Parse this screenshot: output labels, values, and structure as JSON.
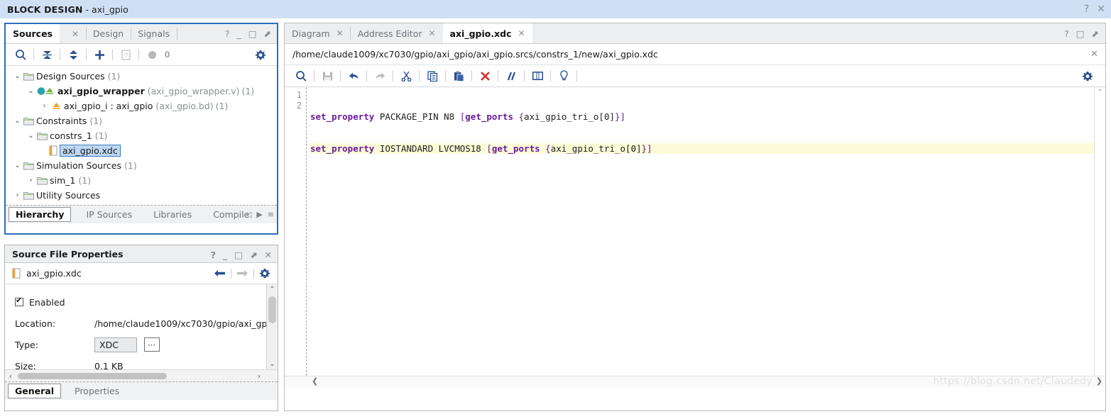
{
  "banner": {
    "title_bold": "BLOCK DESIGN",
    "title_rest": " - axi_gpio",
    "help_icon": "?",
    "close_icon": "✕"
  },
  "sources_panel": {
    "tabs": [
      {
        "label": "Sources",
        "active": true,
        "closable": true
      },
      {
        "label": "Design",
        "active": false,
        "closable": false
      },
      {
        "label": "Signals",
        "active": false,
        "closable": false
      }
    ],
    "close_glyph": "✕",
    "window_controls": [
      "?",
      "_",
      "□",
      "⬈"
    ],
    "toolbar": {
      "search_icon": "search-icon",
      "collapse_icon": "collapse-all-icon",
      "expand_icon": "expand-all-icon",
      "add_icon": "add-sources-icon",
      "file_icon": "report-icon",
      "status_icon": "circle-icon",
      "status_count": "0",
      "settings_icon": "gear-icon"
    },
    "tree": [
      {
        "indent": 0,
        "arrow": "v",
        "icon": "folder",
        "label": "Design Sources",
        "suffix": "(1)",
        "bold": false,
        "selected": false
      },
      {
        "indent": 1,
        "arrow": "v",
        "icon": "module",
        "label": "axi_gpio_wrapper",
        "suffix2": "(axi_gpio_wrapper.v)",
        "suffix": "(1)",
        "bold": true,
        "selected": false
      },
      {
        "indent": 2,
        "arrow": ">",
        "icon": "bd",
        "label": "axi_gpio_i : axi_gpio",
        "suffix2": "(axi_gpio.bd)",
        "suffix": "(1)",
        "bold": false,
        "selected": false
      },
      {
        "indent": 0,
        "arrow": "v",
        "icon": "folder",
        "label": "Constraints",
        "suffix": "(1)",
        "bold": false,
        "selected": false
      },
      {
        "indent": 1,
        "arrow": "v",
        "icon": "folder",
        "label": "constrs_1",
        "suffix": "(1)",
        "bold": false,
        "selected": false
      },
      {
        "indent": 2,
        "arrow": "",
        "icon": "xdc",
        "label": "axi_gpio.xdc",
        "suffix": "",
        "bold": false,
        "selected": true
      },
      {
        "indent": 0,
        "arrow": "v",
        "icon": "folder",
        "label": "Simulation Sources",
        "suffix": "(1)",
        "bold": false,
        "selected": false
      },
      {
        "indent": 1,
        "arrow": ">",
        "icon": "folder",
        "label": "sim_1",
        "suffix": "(1)",
        "bold": false,
        "selected": false
      },
      {
        "indent": 0,
        "arrow": ">",
        "icon": "folder",
        "label": "Utility Sources",
        "suffix": "",
        "bold": false,
        "selected": false
      }
    ],
    "bottom_tabs": [
      {
        "label": "Hierarchy",
        "active": true
      },
      {
        "label": "IP Sources",
        "active": false
      },
      {
        "label": "Libraries",
        "active": false
      },
      {
        "label": "Compile",
        "active": false
      }
    ],
    "bottom_nav": [
      "◁",
      "▶",
      "≡"
    ]
  },
  "properties_panel": {
    "title": "Source File Properties",
    "window_controls": [
      "?",
      "_",
      "□",
      "⬈",
      "✕"
    ],
    "file_name": "axi_gpio.xdc",
    "file_icon": "xdc-file-icon",
    "nav_back_icon": "arrow-left-icon",
    "nav_forward_icon": "arrow-right-icon",
    "settings_icon": "gear-icon",
    "enabled_label": "Enabled",
    "enabled_checked": true,
    "rows": [
      {
        "label": "Location:",
        "value": "/home/claude1009/xc7030/gpio/axi_gp",
        "type": "text"
      },
      {
        "label": "Type:",
        "value": "XDC",
        "type": "field",
        "has_ellipsis": true,
        "ellipsis": "⋯"
      },
      {
        "label": "Size:",
        "value": "0.1 KB",
        "type": "text"
      }
    ],
    "bottom_tabs": [
      {
        "label": "General",
        "active": true
      },
      {
        "label": "Properties",
        "active": false
      }
    ],
    "scroll_up": "⌃",
    "scroll_down": "⌄",
    "scroll_left": "‹",
    "scroll_right": "›"
  },
  "editor_panel": {
    "tabs": [
      {
        "label": "Diagram",
        "active": false,
        "closable": true
      },
      {
        "label": "Address Editor",
        "active": false,
        "closable": true
      },
      {
        "label": "axi_gpio.xdc",
        "active": true,
        "closable": true
      }
    ],
    "close_glyph": "✕",
    "window_controls": [
      "?",
      "□",
      "⬈"
    ],
    "file_path": "/home/claude1009/xc7030/gpio/axi_gpio/axi_gpio.srcs/constrs_1/new/axi_gpio.xdc",
    "path_close_icon": "✕",
    "toolbar_icons": [
      "search-icon",
      "save-icon",
      "undo-icon",
      "redo-icon",
      "cut-icon",
      "copy-icon",
      "paste-icon",
      "delete-icon",
      "comment-icon",
      "table-icon",
      "bulb-icon"
    ],
    "settings_icon": "gear-icon",
    "code_lines": [
      {
        "number": "1",
        "highlight": false,
        "tokens": [
          {
            "t": "set_property",
            "c": "kw"
          },
          {
            "t": " PACKAGE_PIN N8 ",
            "c": "tx"
          },
          {
            "t": "[",
            "c": "pn"
          },
          {
            "t": "get_ports",
            "c": "kw"
          },
          {
            "t": " ",
            "c": "tx"
          },
          {
            "t": "{",
            "c": "pn"
          },
          {
            "t": "axi_gpio_tri_o[0]",
            "c": "tx"
          },
          {
            "t": "}]",
            "c": "pn"
          }
        ]
      },
      {
        "number": "2",
        "highlight": true,
        "tokens": [
          {
            "t": "set_property",
            "c": "kw"
          },
          {
            "t": " IOSTANDARD LVCMOS18 ",
            "c": "tx"
          },
          {
            "t": "[",
            "c": "pn"
          },
          {
            "t": "get_ports",
            "c": "kw"
          },
          {
            "t": " ",
            "c": "tx"
          },
          {
            "t": "{",
            "c": "pn"
          },
          {
            "t": "axi_gpio_tri_o[0]",
            "c": "tx"
          },
          {
            "t": "}]",
            "c": "pn"
          }
        ]
      }
    ],
    "scroll_up": "⌃",
    "scroll_left": "❮",
    "scroll_right": "❯",
    "watermark": "https://blog.csdn.net/Claudedy"
  },
  "colors": {
    "banner_bg": "#cfe0f5",
    "focus_border": "#2c6fbb",
    "keyword": "#6a1b9a",
    "highlight_line": "#fbfbd8",
    "selection": "#bdd7f2",
    "toolbar_icon": "#2a4f8f",
    "delete_red": "#d32f2f"
  }
}
